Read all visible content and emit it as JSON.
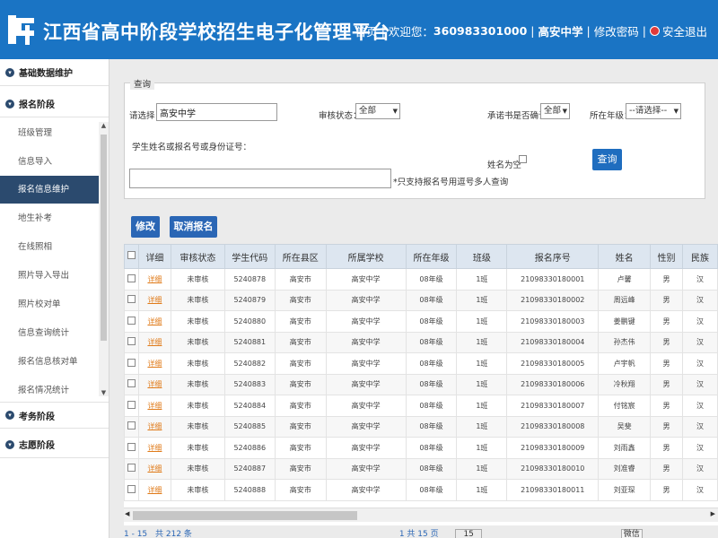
{
  "header": {
    "title": "江西省高中阶段学校招生电子化管理平台",
    "home": "首页",
    "welcome": "欢迎您：",
    "user_id": "360983301000",
    "school": "高安中学",
    "change_password": "修改密码",
    "logout": "安全退出",
    "brand_color": "#1a74c4"
  },
  "sidebar": {
    "sections": [
      {
        "label": "基础数据维护"
      },
      {
        "label": "报名阶段"
      },
      {
        "label": "考务阶段"
      },
      {
        "label": "志愿阶段"
      }
    ],
    "items": [
      {
        "label": "班级管理"
      },
      {
        "label": "信息导入"
      },
      {
        "label": "报名信息维护"
      },
      {
        "label": "地生补考"
      },
      {
        "label": "在线照相"
      },
      {
        "label": "照片导入导出"
      },
      {
        "label": "照片校对单"
      },
      {
        "label": "信息查询统计"
      },
      {
        "label": "报名信息核对单"
      },
      {
        "label": "报名情况统计"
      }
    ],
    "active_color": "#2b4a6e"
  },
  "query": {
    "legend": "查询",
    "select_label": "请选择：",
    "school_value": "高安中学",
    "audit_label": "审核状态：",
    "audit_value": "全部",
    "pledge_label": "承诺书是否确认:",
    "pledge_value": "全部",
    "grade_label": "所在年级：",
    "grade_value": "--请选择--",
    "search_label": "学生姓名或报名号或身份证号：",
    "name_empty_label": "姓名为空",
    "search_hint": "*只支持报名号用逗号多人查询",
    "query_button": "查询"
  },
  "toolbar": {
    "edit": "修改",
    "cancel_registration": "取消报名"
  },
  "table": {
    "headers": [
      "",
      "详细",
      "审核状态",
      "学生代码",
      "所在县区",
      "所属学校",
      "所在年级",
      "班级",
      "报名序号",
      "姓名",
      "性别",
      "民族"
    ],
    "detail_label": "详细",
    "rows": [
      {
        "status": "未审核",
        "code": "5240878",
        "county": "高安市",
        "school": "高安中学",
        "grade": "08年级",
        "class": "1班",
        "reg_no": "21098330180001",
        "name": "卢馨",
        "gender": "男",
        "nation": "汉"
      },
      {
        "status": "未审核",
        "code": "5240879",
        "county": "高安市",
        "school": "高安中学",
        "grade": "08年级",
        "class": "1班",
        "reg_no": "21098330180002",
        "name": "周远峰",
        "gender": "男",
        "nation": "汉"
      },
      {
        "status": "未审核",
        "code": "5240880",
        "county": "高安市",
        "school": "高安中学",
        "grade": "08年级",
        "class": "1班",
        "reg_no": "21098330180003",
        "name": "姜鹏键",
        "gender": "男",
        "nation": "汉"
      },
      {
        "status": "未审核",
        "code": "5240881",
        "county": "高安市",
        "school": "高安中学",
        "grade": "08年级",
        "class": "1班",
        "reg_no": "21098330180004",
        "name": "孙杰伟",
        "gender": "男",
        "nation": "汉"
      },
      {
        "status": "未审核",
        "code": "5240882",
        "county": "高安市",
        "school": "高安中学",
        "grade": "08年级",
        "class": "1班",
        "reg_no": "21098330180005",
        "name": "卢宇帆",
        "gender": "男",
        "nation": "汉"
      },
      {
        "status": "未审核",
        "code": "5240883",
        "county": "高安市",
        "school": "高安中学",
        "grade": "08年级",
        "class": "1班",
        "reg_no": "21098330180006",
        "name": "冷秋翔",
        "gender": "男",
        "nation": "汉"
      },
      {
        "status": "未审核",
        "code": "5240884",
        "county": "高安市",
        "school": "高安中学",
        "grade": "08年级",
        "class": "1班",
        "reg_no": "21098330180007",
        "name": "付铭宸",
        "gender": "男",
        "nation": "汉"
      },
      {
        "status": "未审核",
        "code": "5240885",
        "county": "高安市",
        "school": "高安中学",
        "grade": "08年级",
        "class": "1班",
        "reg_no": "21098330180008",
        "name": "吴斐",
        "gender": "男",
        "nation": "汉"
      },
      {
        "status": "未审核",
        "code": "5240886",
        "county": "高安市",
        "school": "高安中学",
        "grade": "08年级",
        "class": "1班",
        "reg_no": "21098330180009",
        "name": "刘雨鑫",
        "gender": "男",
        "nation": "汉"
      },
      {
        "status": "未审核",
        "code": "5240887",
        "county": "高安市",
        "school": "高安中学",
        "grade": "08年级",
        "class": "1班",
        "reg_no": "21098330180010",
        "name": "刘准睿",
        "gender": "男",
        "nation": "汉"
      },
      {
        "status": "未审核",
        "code": "5240888",
        "county": "高安市",
        "school": "高安中学",
        "grade": "08年级",
        "class": "1班",
        "reg_no": "21098330180011",
        "name": "刘亚琛",
        "gender": "男",
        "nation": "汉"
      }
    ]
  },
  "pager": {
    "range": "1 - 15",
    "total": "共 212 条",
    "page_info": "1 共 15 页",
    "page_size": "15",
    "extra_button": "微信"
  }
}
